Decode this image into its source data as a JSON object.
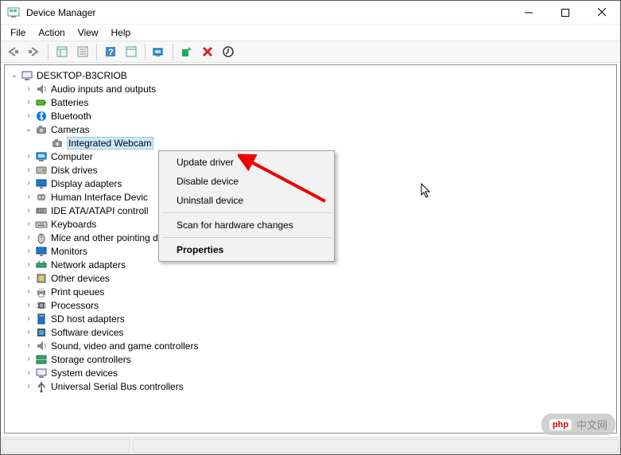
{
  "window": {
    "title": "Device Manager"
  },
  "menu": {
    "file": "File",
    "action": "Action",
    "view": "View",
    "help": "Help"
  },
  "tree": {
    "root": "DESKTOP-B3CRIOB",
    "items": [
      {
        "label": "Audio inputs and outputs",
        "icon": "audio",
        "expanded": false
      },
      {
        "label": "Batteries",
        "icon": "battery",
        "expanded": false
      },
      {
        "label": "Bluetooth",
        "icon": "bluetooth",
        "expanded": false
      },
      {
        "label": "Cameras",
        "icon": "camera",
        "expanded": true,
        "children": [
          {
            "label": "Integrated Webcam",
            "icon": "camera",
            "selected": true
          }
        ]
      },
      {
        "label": "Computer",
        "icon": "computer",
        "expanded": false
      },
      {
        "label": "Disk drives",
        "icon": "disk",
        "expanded": false
      },
      {
        "label": "Display adapters",
        "icon": "display",
        "expanded": false
      },
      {
        "label": "Human Interface Devic",
        "icon": "hid",
        "expanded": false
      },
      {
        "label": "IDE ATA/ATAPI controll",
        "icon": "ide",
        "expanded": false
      },
      {
        "label": "Keyboards",
        "icon": "keyboard",
        "expanded": false
      },
      {
        "label": "Mice and other pointing devices",
        "icon": "mouse",
        "expanded": false
      },
      {
        "label": "Monitors",
        "icon": "monitor",
        "expanded": false
      },
      {
        "label": "Network adapters",
        "icon": "network",
        "expanded": false
      },
      {
        "label": "Other devices",
        "icon": "other",
        "expanded": false
      },
      {
        "label": "Print queues",
        "icon": "printer",
        "expanded": false
      },
      {
        "label": "Processors",
        "icon": "cpu",
        "expanded": false
      },
      {
        "label": "SD host adapters",
        "icon": "sd",
        "expanded": false
      },
      {
        "label": "Software devices",
        "icon": "software",
        "expanded": false
      },
      {
        "label": "Sound, video and game controllers",
        "icon": "sound",
        "expanded": false
      },
      {
        "label": "Storage controllers",
        "icon": "storage",
        "expanded": false
      },
      {
        "label": "System devices",
        "icon": "system",
        "expanded": false
      },
      {
        "label": "Universal Serial Bus controllers",
        "icon": "usb",
        "expanded": false
      }
    ]
  },
  "context_menu": {
    "update": "Update driver",
    "disable": "Disable device",
    "uninstall": "Uninstall device",
    "scan": "Scan for hardware changes",
    "properties": "Properties"
  },
  "watermark": {
    "logo": "php",
    "text": "中文网"
  }
}
